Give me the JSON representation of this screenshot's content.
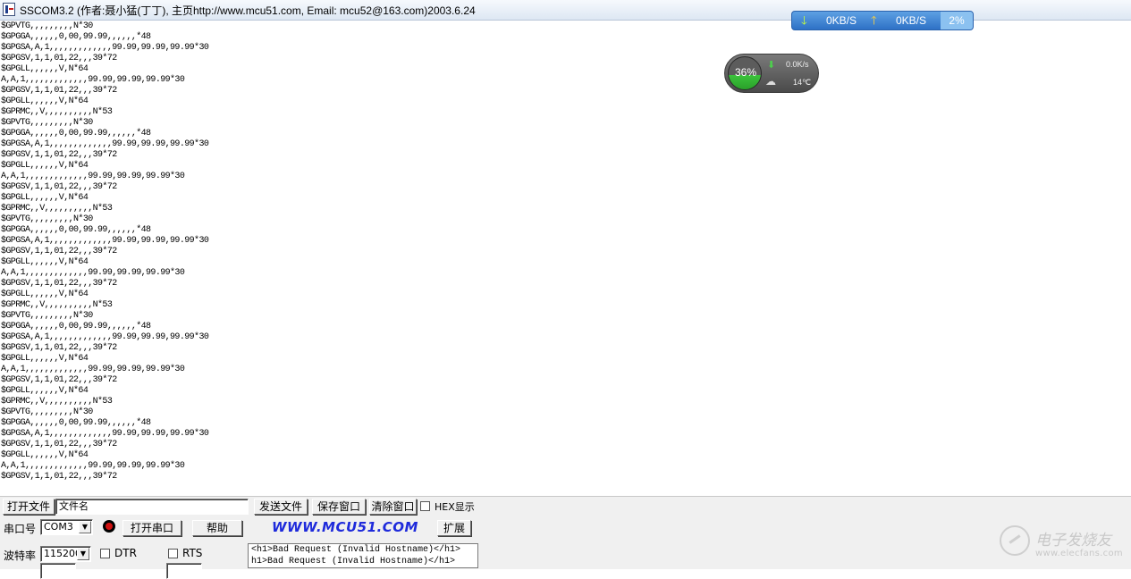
{
  "window": {
    "title": "SSCOM3.2 (作者:聂小猛(丁丁), 主页http://www.mcu51.com,  Email: mcu52@163.com)2003.6.24"
  },
  "terminal": {
    "lines": [
      "$GPVTG,,,,,,,,,N*30",
      "$GPGGA,,,,,,0,00,99.99,,,,,,*48",
      "$GPGSA,A,1,,,,,,,,,,,,,99.99,99.99,99.99*30",
      "$GPGSV,1,1,01,22,,,39*72",
      "$GPGLL,,,,,,V,N*64",
      "A,A,1,,,,,,,,,,,,,99.99,99.99,99.99*30",
      "$GPGSV,1,1,01,22,,,39*72",
      "$GPGLL,,,,,,V,N*64",
      "$GPRMC,,V,,,,,,,,,,N*53",
      "$GPVTG,,,,,,,,,N*30",
      "$GPGGA,,,,,,0,00,99.99,,,,,,*48",
      "$GPGSA,A,1,,,,,,,,,,,,,99.99,99.99,99.99*30",
      "$GPGSV,1,1,01,22,,,39*72",
      "$GPGLL,,,,,,V,N*64",
      "A,A,1,,,,,,,,,,,,,99.99,99.99,99.99*30",
      "$GPGSV,1,1,01,22,,,39*72",
      "$GPGLL,,,,,,V,N*64",
      "$GPRMC,,V,,,,,,,,,,N*53",
      "$GPVTG,,,,,,,,,N*30",
      "$GPGGA,,,,,,0,00,99.99,,,,,,*48",
      "$GPGSA,A,1,,,,,,,,,,,,,99.99,99.99,99.99*30",
      "$GPGSV,1,1,01,22,,,39*72",
      "$GPGLL,,,,,,V,N*64",
      "A,A,1,,,,,,,,,,,,,99.99,99.99,99.99*30",
      "$GPGSV,1,1,01,22,,,39*72",
      "$GPGLL,,,,,,V,N*64",
      "$GPRMC,,V,,,,,,,,,,N*53",
      "$GPVTG,,,,,,,,,N*30",
      "$GPGGA,,,,,,0,00,99.99,,,,,,*48",
      "$GPGSA,A,1,,,,,,,,,,,,,99.99,99.99,99.99*30",
      "$GPGSV,1,1,01,22,,,39*72",
      "$GPGLL,,,,,,V,N*64",
      "A,A,1,,,,,,,,,,,,,99.99,99.99,99.99*30",
      "$GPGSV,1,1,01,22,,,39*72",
      "$GPGLL,,,,,,V,N*64",
      "$GPRMC,,V,,,,,,,,,,N*53",
      "$GPVTG,,,,,,,,,N*30",
      "$GPGGA,,,,,,0,00,99.99,,,,,,*48",
      "$GPGSA,A,1,,,,,,,,,,,,,99.99,99.99,99.99*30",
      "$GPGSV,1,1,01,22,,,39*72",
      "$GPGLL,,,,,,V,N*64",
      "A,A,1,,,,,,,,,,,,,99.99,99.99,99.99*30",
      "$GPGSV,1,1,01,22,,,39*72"
    ]
  },
  "net_monitor": {
    "download": "0KB/S",
    "upload": "0KB/S",
    "cpu": "2%"
  },
  "system_widget": {
    "usage": "36%",
    "speed": "0.0K/s",
    "temperature": "14℃"
  },
  "toolbar": {
    "open_file": "打开文件",
    "filename": "文件名",
    "send_file": "发送文件",
    "save_window": "保存窗口",
    "clear_window": "清除窗口",
    "hex_display": "HEX显示"
  },
  "port": {
    "label": "串口号",
    "selected": "COM3",
    "open_port": "打开串口",
    "help": "帮助",
    "website": "WWW.MCU51.COM",
    "expand": "扩展",
    "led_color": "#d01010"
  },
  "baud": {
    "label": "波特率",
    "selected": "115200",
    "dtr": "DTR",
    "rts": "RTS"
  },
  "response_lines": [
    "<h1>Bad Request (Invalid Hostname)</h1>",
    "h1>Bad Request (Invalid Hostname)</h1>"
  ],
  "watermark": {
    "cn": "电子发烧友",
    "en": "www.elecfans.com"
  }
}
